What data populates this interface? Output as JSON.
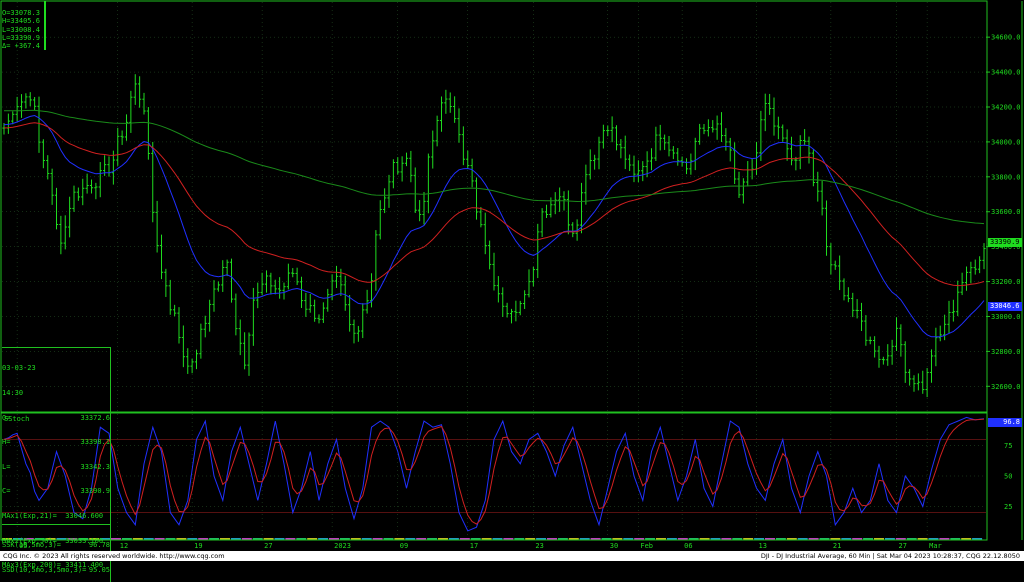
{
  "colors": {
    "bars": "#1fdc1f",
    "ma21": "#2030ff",
    "ma50": "#d02020",
    "ma200": "#1a8a1a",
    "stoch_k": "#2030ff",
    "stoch_d": "#d02020",
    "frame": "#20c020",
    "grid": "#2a5a2a"
  },
  "top_readout": {
    "open": "O=33078.3",
    "high": "H=33405.6",
    "low": "L=33008.4",
    "last": "L=33390.9",
    "delta": "Δ= +367.4"
  },
  "info_box": {
    "date": "03-03-23",
    "time": "14:30",
    "o_label": "O=",
    "o_val": "33372.6",
    "h_label": "H=",
    "h_val": "33398.1",
    "l_label": "L=",
    "l_val": "33342.3",
    "c_label": "C=",
    "c_val": "33390.9",
    "ma1": "MAx1(Exp,21)=  33046.600",
    "ma2": "MAx2(Exp,50)=  33033.100",
    "ma3": "MAx3(Exp,200)= 33411.400"
  },
  "stoch_panel": {
    "title": "SStoch",
    "k_label": "SSK(10,5mo,3)=",
    "k_val": "96.78",
    "d_label": "SSD(10,5mo,3,5mo,3)=",
    "d_val": "95.05",
    "last_tag": "96.8"
  },
  "price_tags": {
    "last": "33390.9",
    "ma21": "33046.6"
  },
  "footer": {
    "left": "CQG Inc. © 2023 All rights reserved worldwide. http://www.cqg.com",
    "right": "DJI - DJ Industrial Average, 60 Min | Sat Mar 04 2023 10:28:37, CQG 22.12.8050"
  },
  "chart_data": {
    "type": "bar",
    "title": "",
    "y_ticks": [
      32600,
      32800,
      33000,
      33200,
      33400,
      33600,
      33800,
      34000,
      34200,
      34400,
      34600
    ],
    "y_tick_labels": [
      "32600.0",
      "32800.0",
      "33000.0",
      "33200.0",
      "33400.0",
      "33600.0",
      "33800.0",
      "34000.0",
      "34200.0",
      "34400.0",
      "34600.0"
    ],
    "ylim": [
      32470,
      34790
    ],
    "x_labels": [
      {
        "label": "05",
        "bar": 3
      },
      {
        "label": "12",
        "bar": 26
      },
      {
        "label": "19",
        "bar": 43
      },
      {
        "label": "27",
        "bar": 59
      },
      {
        "label": "2023",
        "bar": 75
      },
      {
        "label": "09",
        "bar": 90
      },
      {
        "label": "17",
        "bar": 106
      },
      {
        "label": "23",
        "bar": 121
      },
      {
        "label": "30",
        "bar": 138
      },
      {
        "label": "Feb",
        "bar": 145
      },
      {
        "label": "06",
        "bar": 155
      },
      {
        "label": "13",
        "bar": 172
      },
      {
        "label": "21",
        "bar": 189
      },
      {
        "label": "27",
        "bar": 204
      },
      {
        "label": "Mar",
        "bar": 211
      }
    ],
    "bar_count": 225,
    "anchors": [
      [
        0,
        34080
      ],
      [
        3,
        34220
      ],
      [
        6,
        34270
      ],
      [
        9,
        33900
      ],
      [
        13,
        33450
      ],
      [
        16,
        33700
      ],
      [
        20,
        33760
      ],
      [
        24,
        33850
      ],
      [
        27,
        34050
      ],
      [
        30,
        34320
      ],
      [
        32,
        34200
      ],
      [
        34,
        33600
      ],
      [
        36,
        33250
      ],
      [
        39,
        33000
      ],
      [
        41,
        32780
      ],
      [
        43,
        32710
      ],
      [
        45,
        32900
      ],
      [
        48,
        33150
      ],
      [
        51,
        33300
      ],
      [
        53,
        32950
      ],
      [
        55,
        32750
      ],
      [
        57,
        33100
      ],
      [
        60,
        33200
      ],
      [
        63,
        33150
      ],
      [
        66,
        33250
      ],
      [
        69,
        33060
      ],
      [
        72,
        33000
      ],
      [
        76,
        33200
      ],
      [
        80,
        32900
      ],
      [
        83,
        33100
      ],
      [
        86,
        33600
      ],
      [
        89,
        33850
      ],
      [
        92,
        33900
      ],
      [
        95,
        33550
      ],
      [
        98,
        34000
      ],
      [
        100,
        34250
      ],
      [
        103,
        34150
      ],
      [
        106,
        33850
      ],
      [
        109,
        33500
      ],
      [
        112,
        33200
      ],
      [
        115,
        33050
      ],
      [
        117,
        33000
      ],
      [
        120,
        33200
      ],
      [
        123,
        33600
      ],
      [
        127,
        33700
      ],
      [
        130,
        33500
      ],
      [
        134,
        33900
      ],
      [
        138,
        34100
      ],
      [
        141,
        33950
      ],
      [
        144,
        33800
      ],
      [
        147,
        33900
      ],
      [
        150,
        34050
      ],
      [
        153,
        33950
      ],
      [
        156,
        33850
      ],
      [
        159,
        34050
      ],
      [
        162,
        34100
      ],
      [
        165,
        34000
      ],
      [
        168,
        33700
      ],
      [
        171,
        33850
      ],
      [
        174,
        34200
      ],
      [
        177,
        34050
      ],
      [
        180,
        33900
      ],
      [
        183,
        34000
      ],
      [
        186,
        33700
      ],
      [
        189,
        33300
      ],
      [
        192,
        33150
      ],
      [
        195,
        33000
      ],
      [
        198,
        32850
      ],
      [
        201,
        32750
      ],
      [
        204,
        32900
      ],
      [
        207,
        32650
      ],
      [
        210,
        32600
      ],
      [
        213,
        32850
      ],
      [
        216,
        33000
      ],
      [
        219,
        33200
      ],
      [
        222,
        33300
      ],
      [
        224,
        33390
      ]
    ],
    "stoch_ylim": [
      0,
      100
    ],
    "stoch_ticks": [
      25,
      50,
      75
    ],
    "stoch_levels": [
      20,
      80
    ],
    "stoch_k_anchors": [
      [
        0,
        80
      ],
      [
        3,
        85
      ],
      [
        5,
        60
      ],
      [
        8,
        30
      ],
      [
        10,
        40
      ],
      [
        12,
        70
      ],
      [
        14,
        50
      ],
      [
        16,
        20
      ],
      [
        18,
        15
      ],
      [
        20,
        40
      ],
      [
        22,
        90
      ],
      [
        24,
        85
      ],
      [
        26,
        40
      ],
      [
        28,
        20
      ],
      [
        30,
        10
      ],
      [
        32,
        60
      ],
      [
        34,
        90
      ],
      [
        36,
        70
      ],
      [
        38,
        20
      ],
      [
        40,
        10
      ],
      [
        42,
        30
      ],
      [
        44,
        80
      ],
      [
        46,
        95
      ],
      [
        48,
        50
      ],
      [
        50,
        30
      ],
      [
        52,
        70
      ],
      [
        54,
        90
      ],
      [
        56,
        60
      ],
      [
        58,
        30
      ],
      [
        60,
        60
      ],
      [
        62,
        95
      ],
      [
        64,
        60
      ],
      [
        66,
        20
      ],
      [
        68,
        40
      ],
      [
        70,
        70
      ],
      [
        72,
        30
      ],
      [
        74,
        60
      ],
      [
        76,
        80
      ],
      [
        78,
        40
      ],
      [
        80,
        15
      ],
      [
        82,
        40
      ],
      [
        84,
        90
      ],
      [
        86,
        95
      ],
      [
        88,
        90
      ],
      [
        90,
        70
      ],
      [
        92,
        40
      ],
      [
        94,
        70
      ],
      [
        96,
        95
      ],
      [
        98,
        90
      ],
      [
        100,
        92
      ],
      [
        102,
        60
      ],
      [
        104,
        20
      ],
      [
        106,
        5
      ],
      [
        108,
        8
      ],
      [
        110,
        30
      ],
      [
        112,
        80
      ],
      [
        114,
        95
      ],
      [
        116,
        70
      ],
      [
        118,
        60
      ],
      [
        120,
        80
      ],
      [
        122,
        85
      ],
      [
        124,
        70
      ],
      [
        126,
        50
      ],
      [
        128,
        75
      ],
      [
        130,
        90
      ],
      [
        132,
        60
      ],
      [
        134,
        30
      ],
      [
        136,
        10
      ],
      [
        138,
        40
      ],
      [
        140,
        70
      ],
      [
        142,
        85
      ],
      [
        144,
        50
      ],
      [
        146,
        30
      ],
      [
        148,
        70
      ],
      [
        150,
        90
      ],
      [
        152,
        60
      ],
      [
        154,
        30
      ],
      [
        156,
        50
      ],
      [
        158,
        80
      ],
      [
        160,
        40
      ],
      [
        162,
        25
      ],
      [
        164,
        60
      ],
      [
        166,
        95
      ],
      [
        168,
        90
      ],
      [
        170,
        60
      ],
      [
        172,
        40
      ],
      [
        174,
        30
      ],
      [
        176,
        60
      ],
      [
        178,
        80
      ],
      [
        180,
        40
      ],
      [
        182,
        20
      ],
      [
        184,
        50
      ],
      [
        186,
        70
      ],
      [
        188,
        50
      ],
      [
        190,
        10
      ],
      [
        192,
        20
      ],
      [
        194,
        40
      ],
      [
        196,
        20
      ],
      [
        198,
        30
      ],
      [
        200,
        60
      ],
      [
        202,
        30
      ],
      [
        204,
        20
      ],
      [
        206,
        50
      ],
      [
        208,
        40
      ],
      [
        210,
        25
      ],
      [
        212,
        55
      ],
      [
        214,
        80
      ],
      [
        216,
        92
      ],
      [
        218,
        95
      ],
      [
        220,
        98
      ],
      [
        222,
        96
      ],
      [
        224,
        97
      ]
    ]
  }
}
